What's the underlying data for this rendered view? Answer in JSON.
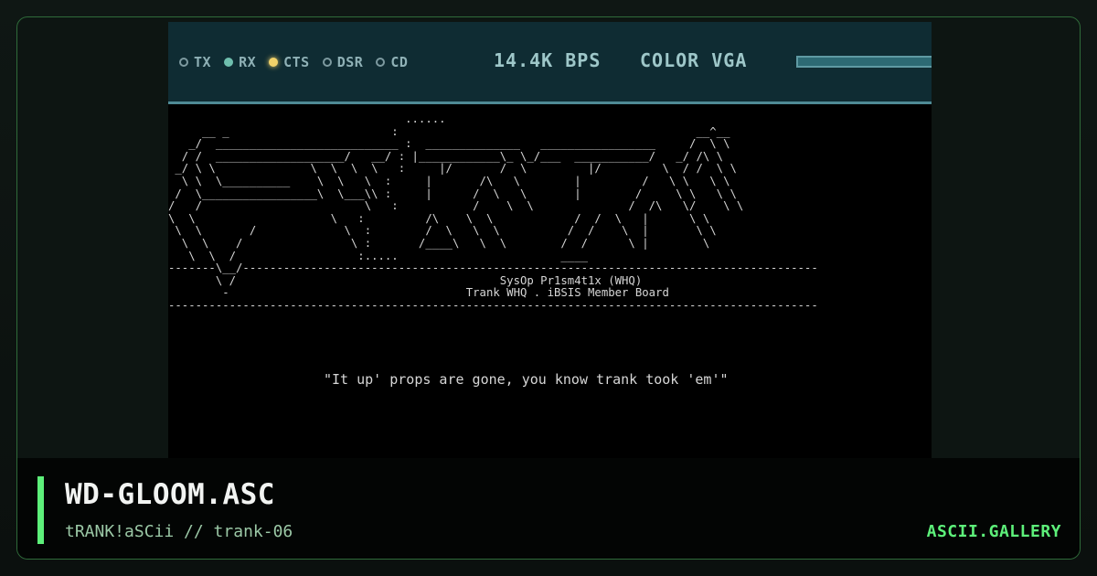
{
  "status_bar": {
    "indicators": [
      {
        "label": "TX",
        "state": "off"
      },
      {
        "label": "RX",
        "state": "green"
      },
      {
        "label": "CTS",
        "state": "yellow"
      },
      {
        "label": "DSR",
        "state": "off"
      },
      {
        "label": "CD",
        "state": "off"
      }
    ],
    "baud_rate": "14.4K BPS",
    "display_mode": "COLOR VGA",
    "line_progress": 1.0
  },
  "terminal": {
    "art": "                                   ......\n     __ _                        :                                            __^__\n   _/  ___________________________ :  ______________   _________________     /  \\ \\\n  / /  ___________________/   __/ : |____________\\_ \\_/___  ___________/   _/ /\\ \\\n _/ \\ \\              \\  \\  \\  \\   :     |/       /  \\         |/         \\  / /  \\ \\\n  \\ \\  \\__________    \\  \\   \\  :     |       /\\   \\        |         /   \\ \\   \\ \\\n /  \\_________________\\  \\___\\\\ :     |      /  \\   \\       |        /     \\ \\   \\ \\\n/   /                        \\   :           /    \\  \\              /  /\\   \\/    \\ \\\n\\  \\                    \\   :         /\\    \\  \\            /  /  \\   |      \\ \\\n \\  \\       /             \\  :        /  \\   \\  \\          /  /    \\  |       \\ \\\n  \\  \\    /                \\ :       /____\\   \\  \\        /  /      \\ |        \\\n   \\  \\  /                  :.....                        ____\n-------\\__/-------------------------------------------------------------------------------------\n       \\ /                                       SysOp Pr1sm4t1x (WHQ)\n        -                                   Trank WHQ . iBSIS Member Board\n------------------------------------------------------------------------------------------------",
    "tagline": "\"It up' props are gone, you know trank took 'em'\""
  },
  "caption": {
    "title": "WD-GLOOM.ASC",
    "subtitle": "tRANK!aSCii // trank-06",
    "brand": "ASCII.GALLERY",
    "accent_color": "#5df07a"
  }
}
